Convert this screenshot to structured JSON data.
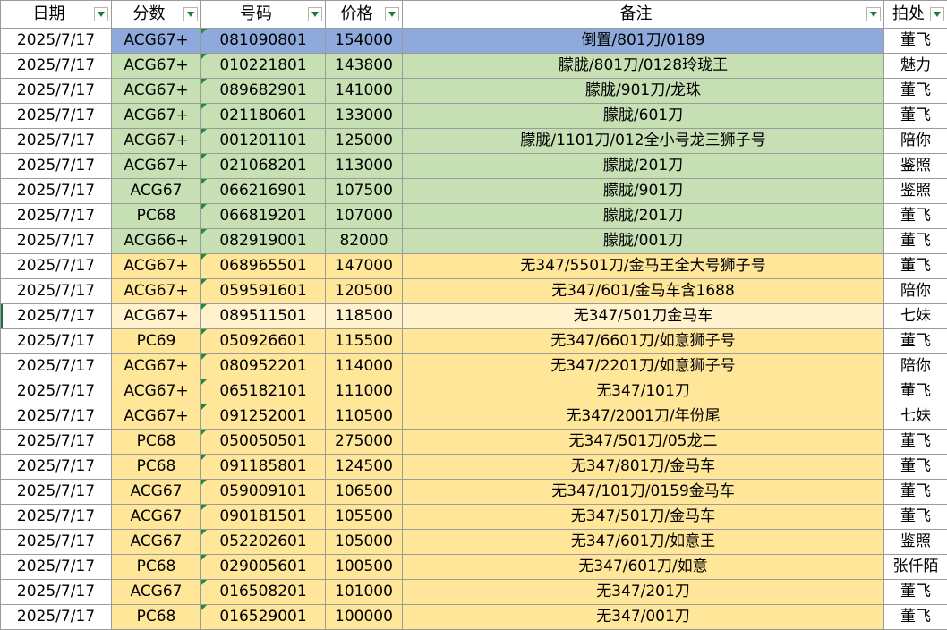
{
  "headers": {
    "date": "日期",
    "score": "分数",
    "number": "号码",
    "price": "价格",
    "note": "备注",
    "location": "拍处"
  },
  "rows": [
    {
      "date": "2025/7/17",
      "score": "ACG67+",
      "number": "081090801",
      "price": "154000",
      "note": "倒置/801刀/0189",
      "location": "董飞",
      "fill": "blue"
    },
    {
      "date": "2025/7/17",
      "score": "ACG67+",
      "number": "010221801",
      "price": "143800",
      "note": "朦胧/801刀/0128玲珑王",
      "location": "魅力",
      "fill": "g"
    },
    {
      "date": "2025/7/17",
      "score": "ACG67+",
      "number": "089682901",
      "price": "141000",
      "note": "朦胧/901刀/龙珠",
      "location": "董飞",
      "fill": "g"
    },
    {
      "date": "2025/7/17",
      "score": "ACG67+",
      "number": "021180601",
      "price": "133000",
      "note": "朦胧/601刀",
      "location": "董飞",
      "fill": "g"
    },
    {
      "date": "2025/7/17",
      "score": "ACG67+",
      "number": "001201101",
      "price": "125000",
      "note": "朦胧/1101刀/012全小号龙三狮子号",
      "location": "陪你",
      "fill": "g"
    },
    {
      "date": "2025/7/17",
      "score": "ACG67+",
      "number": "021068201",
      "price": "113000",
      "note": "朦胧/201刀",
      "location": "鉴照",
      "fill": "g"
    },
    {
      "date": "2025/7/17",
      "score": "ACG67",
      "number": "066216901",
      "price": "107500",
      "note": "朦胧/901刀",
      "location": "鉴照",
      "fill": "g"
    },
    {
      "date": "2025/7/17",
      "score": "PC68",
      "number": "066819201",
      "price": "107000",
      "note": "朦胧/201刀",
      "location": "董飞",
      "fill": "g"
    },
    {
      "date": "2025/7/17",
      "score": "ACG66+",
      "number": "082919001",
      "price": "82000",
      "note": "朦胧/001刀",
      "location": "董飞",
      "fill": "g"
    },
    {
      "date": "2025/7/17",
      "score": "ACG67+",
      "number": "068965501",
      "price": "147000",
      "note": "无347/5501刀/金马王全大号狮子号",
      "location": "董飞",
      "fill": "y"
    },
    {
      "date": "2025/7/17",
      "score": "ACG67+",
      "number": "059591601",
      "price": "120500",
      "note": "无347/601/金马车含1688",
      "location": "陪你",
      "fill": "y"
    },
    {
      "date": "2025/7/17",
      "score": "ACG67+",
      "number": "089511501",
      "price": "118500",
      "note": "无347/501刀金马车",
      "location": "七妹",
      "fill": "sel"
    },
    {
      "date": "2025/7/17",
      "score": "PC69",
      "number": "050926601",
      "price": "115500",
      "note": "无347/6601刀/如意狮子号",
      "location": "董飞",
      "fill": "y"
    },
    {
      "date": "2025/7/17",
      "score": "ACG67+",
      "number": "080952201",
      "price": "114000",
      "note": "无347/2201刀/如意狮子号",
      "location": "陪你",
      "fill": "y"
    },
    {
      "date": "2025/7/17",
      "score": "ACG67+",
      "number": "065182101",
      "price": "111000",
      "note": "无347/101刀",
      "location": "董飞",
      "fill": "y"
    },
    {
      "date": "2025/7/17",
      "score": "ACG67+",
      "number": "091252001",
      "price": "110500",
      "note": "无347/2001刀/年份尾",
      "location": "七妹",
      "fill": "y"
    },
    {
      "date": "2025/7/17",
      "score": "PC68",
      "number": "050050501",
      "price": "275000",
      "note": "无347/501刀/05龙二",
      "location": "董飞",
      "fill": "y"
    },
    {
      "date": "2025/7/17",
      "score": "PC68",
      "number": "091185801",
      "price": "124500",
      "note": "无347/801刀/金马车",
      "location": "董飞",
      "fill": "y"
    },
    {
      "date": "2025/7/17",
      "score": "ACG67",
      "number": "059009101",
      "price": "106500",
      "note": "无347/101刀/0159金马车",
      "location": "董飞",
      "fill": "y"
    },
    {
      "date": "2025/7/17",
      "score": "ACG67",
      "number": "090181501",
      "price": "105500",
      "note": "无347/501刀/金马车",
      "location": "董飞",
      "fill": "y"
    },
    {
      "date": "2025/7/17",
      "score": "ACG67",
      "number": "052202601",
      "price": "105000",
      "note": "无347/601刀/如意王",
      "location": "鉴照",
      "fill": "y"
    },
    {
      "date": "2025/7/17",
      "score": "PC68",
      "number": "029005601",
      "price": "100500",
      "note": "无347/601刀/如意",
      "location": "张仟陌",
      "fill": "y"
    },
    {
      "date": "2025/7/17",
      "score": "ACG67",
      "number": "016508201",
      "price": "101000",
      "note": "无347/201刀",
      "location": "董飞",
      "fill": "y"
    },
    {
      "date": "2025/7/17",
      "score": "PC68",
      "number": "016529001",
      "price": "100000",
      "note": "无347/001刀",
      "location": "董飞",
      "fill": "y"
    }
  ],
  "colors": {
    "green_fill": "#c6e0b4",
    "yellow_fill": "#ffe699",
    "selected_fill": "#fff2cc",
    "blue_fill": "#8ea9db",
    "filter_arrow": "#1f7a3a"
  },
  "icons": {
    "filter": "filter-dropdown-icon"
  }
}
